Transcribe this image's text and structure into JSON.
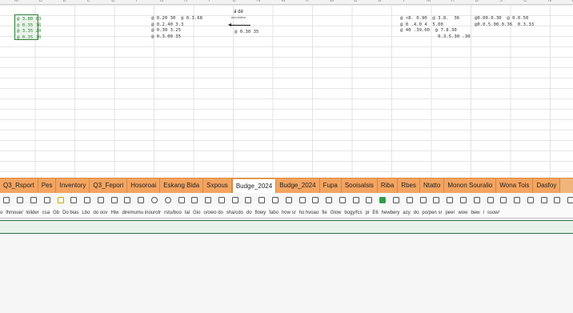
{
  "column_headers": [
    "M",
    "G",
    "B",
    "E",
    "D",
    "F",
    "G",
    "H",
    "I",
    "B",
    "N",
    "W",
    "R",
    "W",
    "D",
    "B",
    "T",
    "M",
    "H",
    "D",
    "S",
    "C",
    "N",
    "E"
  ],
  "cells": {
    "selected_block": [
      "@ 3.80 83",
      "@ 0.35 36",
      "@ 3.35 20",
      "@ 0.35 30"
    ],
    "block_a": [
      "@ 0.20 30  @ 0.3.68",
      "@ 0.2.40 3.3",
      "@ 0.30 3.25",
      "@ 0.3.00 35"
    ],
    "block_b": [
      "@ <8. 0.90  @ 3.8.  36",
      "@ 0 .4.0 4  5.00",
      "@ 40 .39.00  @ 7.8.30",
      "              0.3.5.30 .30"
    ],
    "block_c": [
      "@0.00.0.30  @ 0.0.50",
      "@0.0.5.00.0.36  0.3.33"
    ]
  },
  "annotation": {
    "title": "ä dé",
    "subtitle": "annotation"
  },
  "sheet_tabs": [
    {
      "label": "Q3_Rsport"
    },
    {
      "label": "Pes"
    },
    {
      "label": "Inventory"
    },
    {
      "label": "Q3_Fepori"
    },
    {
      "label": "Hosoroai"
    },
    {
      "label": "Eskang Bida"
    },
    {
      "label": "Sxpous"
    },
    {
      "label": "Budge_2024",
      "active": true
    },
    {
      "label": "Budge_2024"
    },
    {
      "label": "Fupa"
    },
    {
      "label": "Sooisalsis"
    },
    {
      "label": "Riba"
    },
    {
      "label": "Rbes"
    },
    {
      "label": "Ntatto"
    },
    {
      "label": "Monon Souralio"
    },
    {
      "label": "Wona Tois"
    },
    {
      "label": "Dasfoy"
    }
  ],
  "toolbar_icons": [
    "file-icon",
    "bold-icon",
    "chart-icon",
    "alert-icon",
    "image-icon",
    "table-icon",
    "comment-icon",
    "copy-icon",
    "document-icon",
    "format-icon",
    "grid-icon",
    "circle-icon",
    "shape-icon",
    "text-icon",
    "frame-icon",
    "save-icon",
    "paste-icon",
    "link-icon",
    "tag-icon",
    "filter-icon",
    "chat-icon",
    "cell-icon",
    "page-icon",
    "camera-icon",
    "mail-icon",
    "layout-icon",
    "view-icon",
    "status-icon",
    "green-dot-icon",
    "display-icon",
    "clip-icon",
    "note-icon",
    "list-icon",
    "sort-icon",
    "pie-icon",
    "box-icon",
    "print-icon",
    "folder-icon",
    "star-icon",
    "bar-icon",
    "sum-icon",
    "range-icon",
    "clock-icon",
    "edit-icon",
    "export-icon",
    "data-icon",
    "lock-icon",
    "lookup-icon",
    "pivot-icon",
    "zoom-icon",
    "share-icon"
  ],
  "toolbar_labels": [
    "o",
    "lhmoue/",
    "lolider",
    "csa",
    "Gb",
    "Do bias",
    "Lbo",
    "do oov",
    "Hiw",
    "diremumu inourotr",
    "rstu/boo",
    "tai",
    "Gio",
    "o/owo do",
    "sha/cdo",
    "do",
    "flowy",
    "fabo",
    "how sr",
    "ho hvoao",
    "fie",
    "Glow",
    "bogy/fcs",
    "pi",
    "E6",
    "hewbery",
    "azy",
    "do",
    "po/pen sr",
    "peer",
    "wow",
    "bew",
    "l",
    "ssow/"
  ]
}
